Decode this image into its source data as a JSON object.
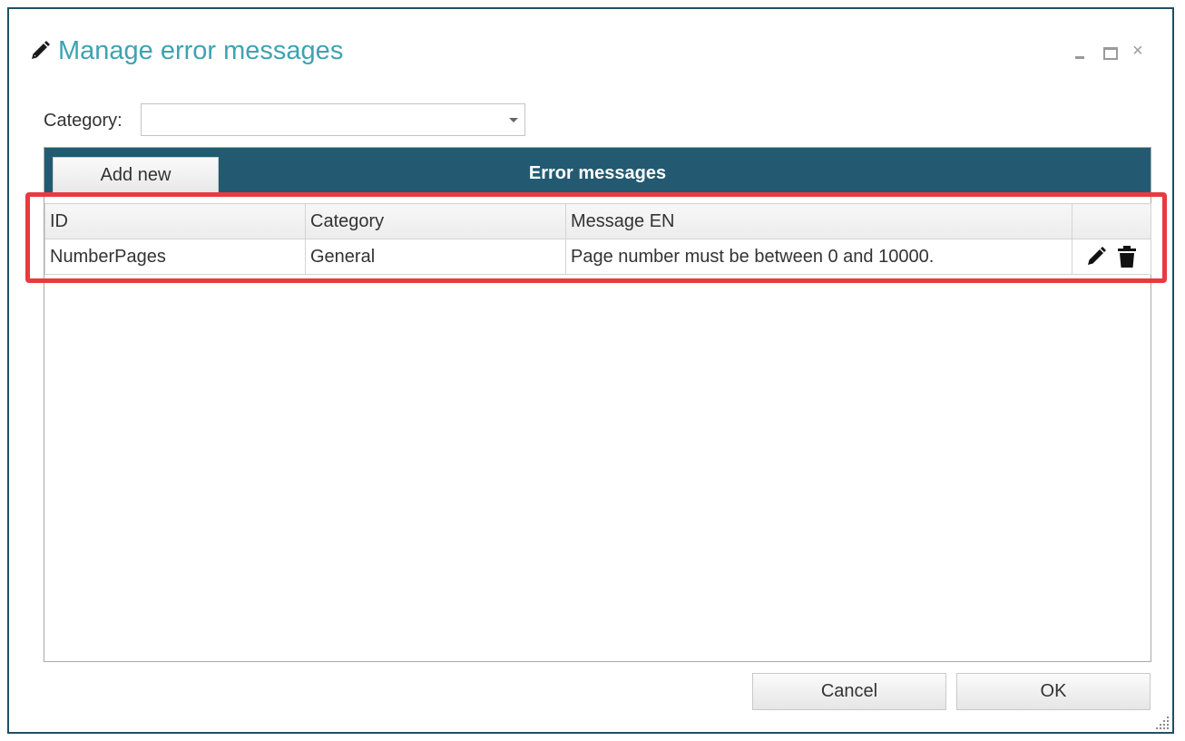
{
  "window": {
    "title": "Manage error messages",
    "title_icon": "pencil-icon",
    "controls": [
      "minimize-icon",
      "maximize-icon",
      "close-icon"
    ],
    "close_glyph": "×"
  },
  "filter": {
    "label": "Category:",
    "selected_value": ""
  },
  "grid": {
    "add_button_label": "Add new",
    "title": "Error messages",
    "columns": [
      "ID",
      "Category",
      "Message EN",
      ""
    ],
    "rows": [
      {
        "id": "NumberPages",
        "category": "General",
        "message": "Page number must be between 0 and 10000.",
        "actions": [
          "pencil-icon",
          "trash-icon"
        ]
      }
    ]
  },
  "footer": {
    "cancel_label": "Cancel",
    "ok_label": "OK"
  },
  "colors": {
    "title": "#3ea3b0",
    "header_bar": "#235a72",
    "window_border": "#1f4f66",
    "highlight": "#e83a3f"
  }
}
